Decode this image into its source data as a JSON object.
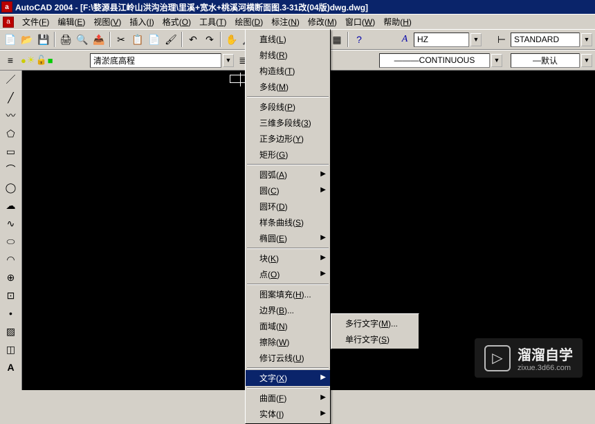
{
  "title": "AutoCAD 2004 - [F:\\婺源县江岭山洪沟治理\\里溪+宽水+桃溪河横断面图.3-31改(04版)dwg.dwg]",
  "menubar": [
    {
      "label": "文件",
      "key": "F"
    },
    {
      "label": "编辑",
      "key": "E"
    },
    {
      "label": "视图",
      "key": "V"
    },
    {
      "label": "插入",
      "key": "I"
    },
    {
      "label": "格式",
      "key": "O"
    },
    {
      "label": "工具",
      "key": "T"
    },
    {
      "label": "绘图",
      "key": "D"
    },
    {
      "label": "标注",
      "key": "N"
    },
    {
      "label": "修改",
      "key": "M"
    },
    {
      "label": "窗口",
      "key": "W"
    },
    {
      "label": "帮助",
      "key": "H"
    }
  ],
  "layer_current": "清淤底高程",
  "textstyle_current": "HZ",
  "dimstyle_current": "STANDARD",
  "linetype_current": "CONTINUOUS",
  "plotstyle_current": "默认",
  "draw_menu": {
    "items": [
      {
        "label": "直线",
        "key": "L"
      },
      {
        "label": "射线",
        "key": "R"
      },
      {
        "label": "构造线",
        "key": "T"
      },
      {
        "label": "多线",
        "key": "M"
      },
      {
        "sep": true
      },
      {
        "label": "多段线",
        "key": "P"
      },
      {
        "label": "三维多段线",
        "key": "3"
      },
      {
        "label": "正多边形",
        "key": "Y"
      },
      {
        "label": "矩形",
        "key": "G"
      },
      {
        "sep": true
      },
      {
        "label": "圆弧",
        "key": "A",
        "sub": true
      },
      {
        "label": "圆",
        "key": "C",
        "sub": true
      },
      {
        "label": "圆环",
        "key": "D"
      },
      {
        "label": "样条曲线",
        "key": "S"
      },
      {
        "label": "椭圆",
        "key": "E",
        "sub": true
      },
      {
        "sep": true
      },
      {
        "label": "块",
        "key": "K",
        "sub": true
      },
      {
        "label": "点",
        "key": "O",
        "sub": true
      },
      {
        "sep": true
      },
      {
        "label": "图案填充",
        "key": "H",
        "dots": true
      },
      {
        "label": "边界",
        "key": "B",
        "dots": true
      },
      {
        "label": "面域",
        "key": "N"
      },
      {
        "label": "擦除",
        "key": "W"
      },
      {
        "label": "修订云线",
        "key": "U"
      },
      {
        "sep": true
      },
      {
        "label": "文字",
        "key": "X",
        "sub": true,
        "hl": true
      },
      {
        "sep": true
      },
      {
        "label": "曲面",
        "key": "F",
        "sub": true
      },
      {
        "label": "实体",
        "key": "I",
        "sub": true
      }
    ]
  },
  "text_submenu": {
    "items": [
      {
        "label": "多行文字",
        "key": "M",
        "dots": true
      },
      {
        "label": "单行文字",
        "key": "S"
      }
    ]
  },
  "watermark": {
    "main": "溜溜自学",
    "sub": "zixue.3d66.com"
  }
}
